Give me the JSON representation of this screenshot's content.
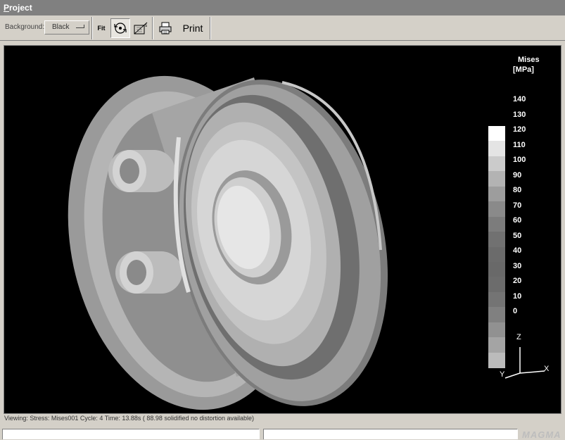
{
  "window": {
    "title_first": "P",
    "title_rest": "roject"
  },
  "toolbar": {
    "background_label": "Background:",
    "background_value": "Black",
    "fit_label": "Fit",
    "print_label": "Print"
  },
  "viewport": {
    "background_color": "#000000",
    "legend": {
      "title_line1": "Mises",
      "title_line2": "[MPa]",
      "ticks": [
        "140",
        "130",
        "120",
        "110",
        "100",
        "90",
        "80",
        "70",
        "60",
        "50",
        "40",
        "30",
        "20",
        "10",
        "0"
      ]
    },
    "axes": {
      "z": "Z",
      "x": "X",
      "y": "Y"
    }
  },
  "status": {
    "text": "Viewing: Stress: Mises001 Cycle: 4  Time: 13.88s ( 88.98 solidified  no distortion available)"
  },
  "logo": {
    "text": "MAGMA"
  },
  "icons": [
    "rotate-icon",
    "view-zoom-icon",
    "printer-icon"
  ]
}
